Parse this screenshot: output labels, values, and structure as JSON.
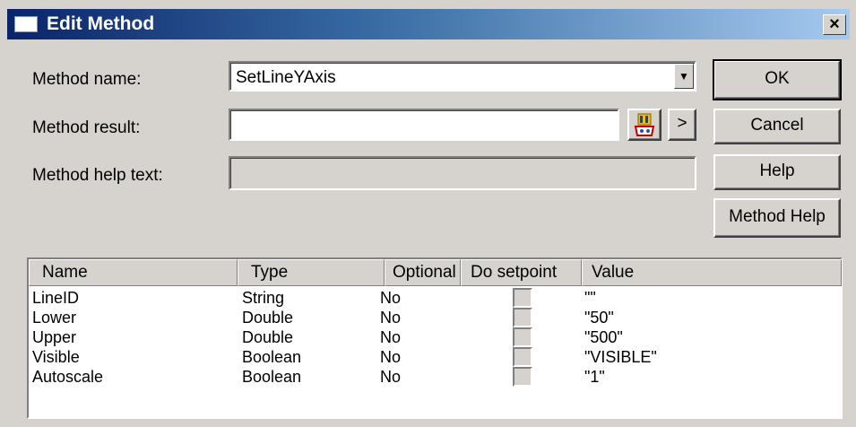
{
  "window": {
    "title": "Edit Method",
    "close_label": "×"
  },
  "form": {
    "method_name_label": "Method name:",
    "method_name_value": "SetLineYAxis",
    "method_result_label": "Method result:",
    "method_result_value": "",
    "method_help_label": "Method help text:",
    "method_help_value": "",
    "browse_arrow_label": ">"
  },
  "buttons": {
    "ok": "OK",
    "cancel": "Cancel",
    "help": "Help",
    "method_help": "Method Help"
  },
  "table": {
    "columns": [
      "Name",
      "Type",
      "Optional",
      "Do setpoint",
      "Value"
    ],
    "rows": [
      {
        "name": "LineID",
        "type": "String",
        "optional": "No",
        "do_setpoint": false,
        "value": "\"\""
      },
      {
        "name": "Lower",
        "type": "Double",
        "optional": "No",
        "do_setpoint": false,
        "value": "\"50\""
      },
      {
        "name": "Upper",
        "type": "Double",
        "optional": "No",
        "do_setpoint": false,
        "value": "\"500\""
      },
      {
        "name": "Visible",
        "type": "Boolean",
        "optional": "No",
        "do_setpoint": false,
        "value": "\"VISIBLE\""
      },
      {
        "name": "Autoscale",
        "type": "Boolean",
        "optional": "No",
        "do_setpoint": false,
        "value": "\"1\""
      }
    ]
  }
}
